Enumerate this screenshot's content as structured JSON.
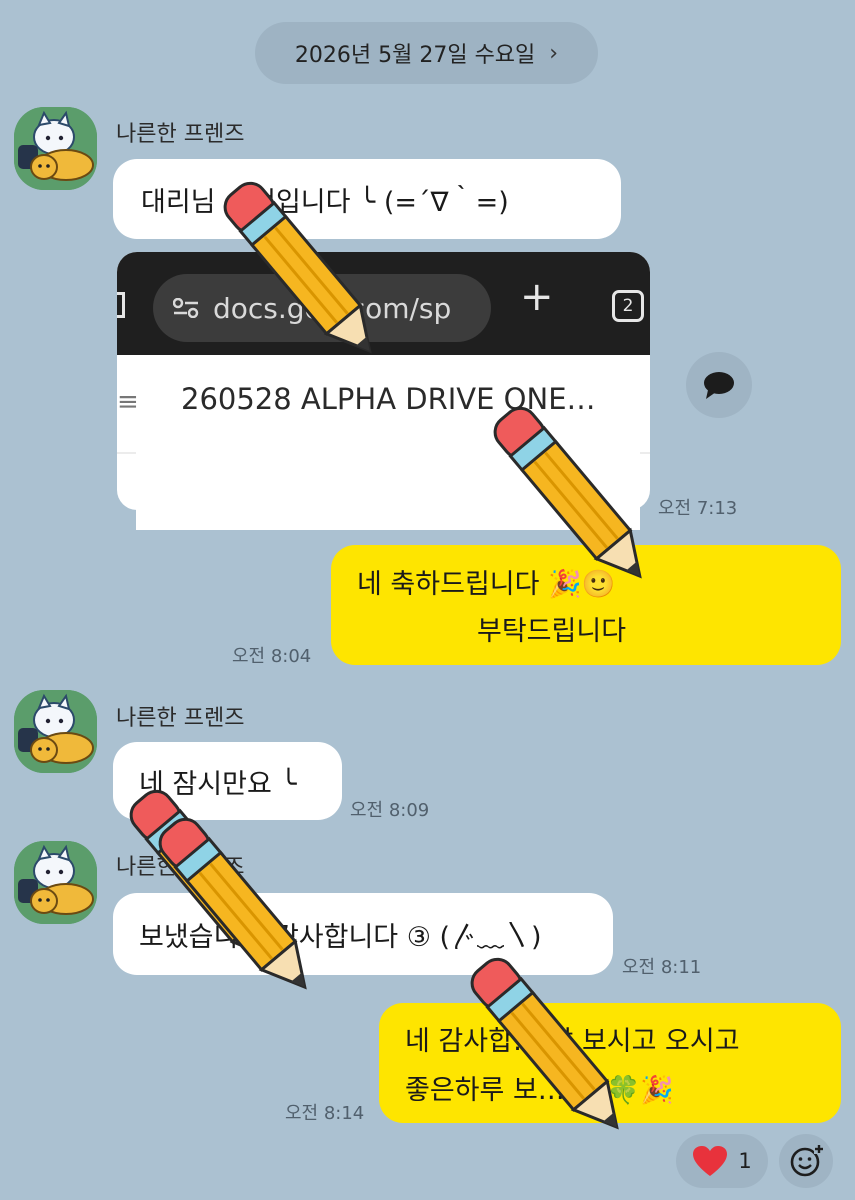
{
  "date_header": {
    "label": "2026년 5월 27일 수요일",
    "chevron_icon": "chevron-right-icon"
  },
  "sender_name": "나른한 프렌즈",
  "messages": [
    {
      "type": "incoming",
      "text": "대리님 …번입니다 ╰ (=´∇｀=)"
    },
    {
      "type": "incoming-image",
      "url_text": "docs.go…com/sp",
      "tab_count": "2",
      "doc_title": "260528 ALPHA DRIVE ONE…",
      "time": "오전 7:13"
    },
    {
      "type": "outgoing",
      "line1": "네 축하드립니다 🎉🙂",
      "line2": "부탁드립니다",
      "time": "오전 8:04"
    },
    {
      "type": "incoming",
      "text": "네 잠시만요 ╰",
      "time": "오전 8:09"
    },
    {
      "type": "incoming",
      "text": "보냈습니… 감사합니다 ③ (〴﹏〵)",
      "time": "오전 8:11"
    },
    {
      "type": "outgoing",
      "line1": "네 감사합… 잘 보시고 오시고",
      "line2": "좋은하루 보… 요 🍀🎉",
      "time": "오전 8:14"
    }
  ],
  "reaction": {
    "icon": "heart-icon",
    "count": "1",
    "color": "#e8323c"
  },
  "colors": {
    "background": "#abc1d1",
    "my_bubble": "#fee500",
    "their_bubble": "#ffffff"
  },
  "overlay_icons": [
    "pencil-sticker-icon"
  ]
}
